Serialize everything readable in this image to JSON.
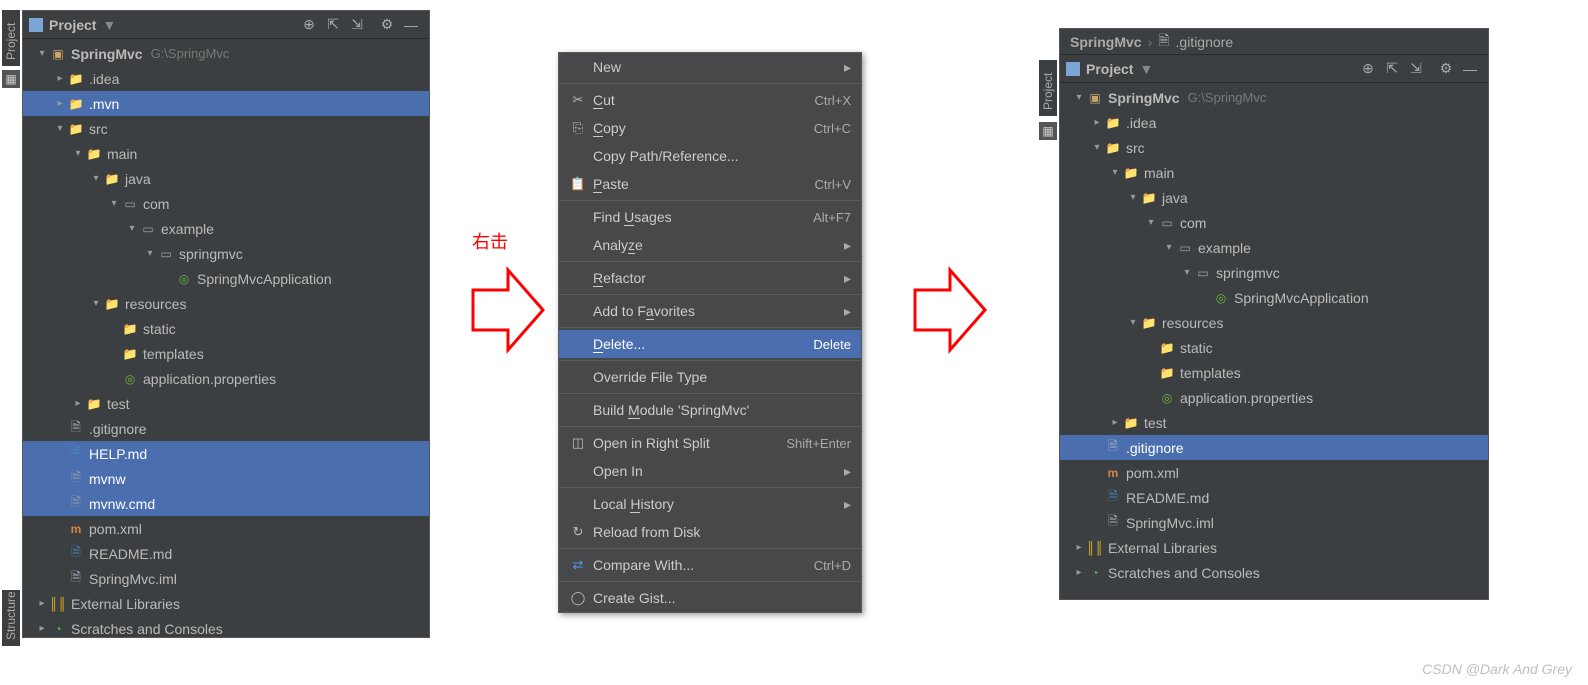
{
  "leftSidebar": {
    "project": "Project",
    "structure": "Structure"
  },
  "rightSidebar": {
    "project": "Project"
  },
  "panel1": {
    "header": {
      "label": "Project"
    },
    "tree": {
      "root": {
        "name": "SpringMvc",
        "path": "G:\\SpringMvc"
      },
      "idea": ".idea",
      "mvn": ".mvn",
      "src": "src",
      "main": "main",
      "java": "java",
      "com": "com",
      "example": "example",
      "springmvc": "springmvc",
      "app": "SpringMvcApplication",
      "resources": "resources",
      "static": "static",
      "templates": "templates",
      "appprops": "application.properties",
      "test": "test",
      "gitignore": ".gitignore",
      "help": "HELP.md",
      "mvnw": "mvnw",
      "mvnwcmd": "mvnw.cmd",
      "pom": "pom.xml",
      "readme": "README.md",
      "iml": "SpringMvc.iml",
      "extlib": "External Libraries",
      "scratches": "Scratches and Consoles"
    }
  },
  "annotation": {
    "right_click": "右击"
  },
  "contextMenu": {
    "new": "New",
    "cut": {
      "label": "Cut",
      "shortcut": "Ctrl+X"
    },
    "copy": {
      "label": "Copy",
      "shortcut": "Ctrl+C"
    },
    "copypath": "Copy Path/Reference...",
    "paste": {
      "label": "Paste",
      "shortcut": "Ctrl+V"
    },
    "findusages": {
      "label": "Find Usages",
      "shortcut": "Alt+F7"
    },
    "analyze": "Analyze",
    "refactor": "Refactor",
    "favorites": "Add to Favorites",
    "delete": {
      "label": "Delete...",
      "shortcut": "Delete"
    },
    "override": "Override File Type",
    "build": "Build Module 'SpringMvc'",
    "rightsplit": {
      "label": "Open in Right Split",
      "shortcut": "Shift+Enter"
    },
    "openin": "Open In",
    "localhistory": "Local History",
    "reload": "Reload from Disk",
    "compare": {
      "label": "Compare With...",
      "shortcut": "Ctrl+D"
    },
    "gist": "Create Gist..."
  },
  "panel2": {
    "breadcrumb": {
      "root": "SpringMvc",
      "file": ".gitignore"
    },
    "header": {
      "label": "Project"
    },
    "tree": {
      "root": {
        "name": "SpringMvc",
        "path": "G:\\SpringMvc"
      },
      "idea": ".idea",
      "src": "src",
      "main": "main",
      "java": "java",
      "com": "com",
      "example": "example",
      "springmvc": "springmvc",
      "app": "SpringMvcApplication",
      "resources": "resources",
      "static": "static",
      "templates": "templates",
      "appprops": "application.properties",
      "test": "test",
      "gitignore": ".gitignore",
      "pom": "pom.xml",
      "readme": "README.md",
      "iml": "SpringMvc.iml",
      "extlib": "External Libraries",
      "scratches": "Scratches and Consoles"
    }
  },
  "watermark": "CSDN @Dark And Grey"
}
